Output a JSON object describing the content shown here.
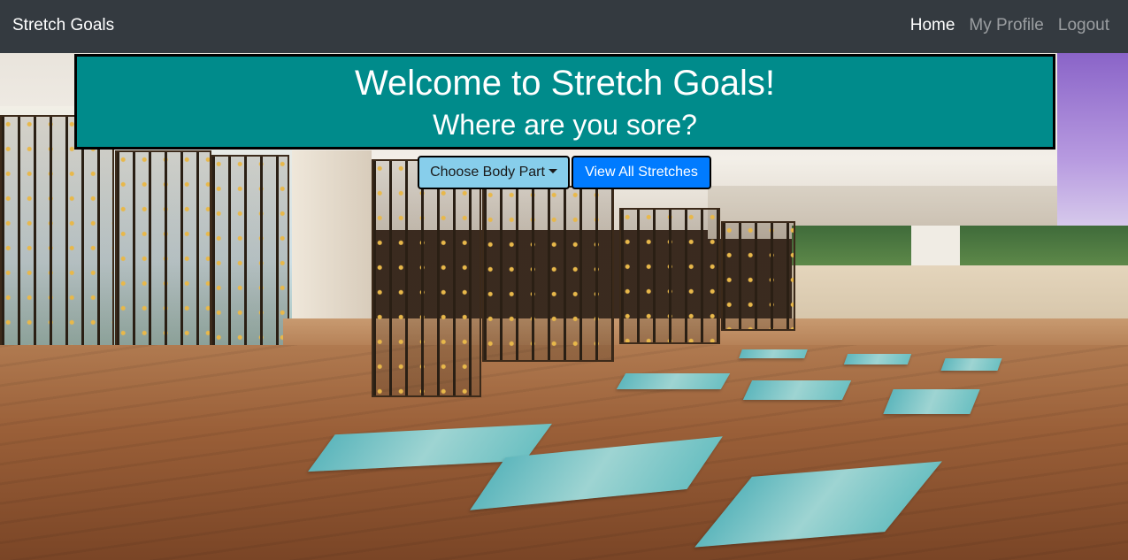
{
  "navbar": {
    "brand": "Stretch Goals",
    "links": [
      "Home",
      "My Profile",
      "Logout"
    ],
    "active_link": "Home"
  },
  "hero": {
    "title": "Welcome to Stretch Goals!",
    "subtitle": "Where are you sore?"
  },
  "actions": {
    "choose_body_part": "Choose Body Part",
    "view_all": "View All Stretches"
  },
  "colors": {
    "navbar_bg": "#343a40",
    "jumbotron_bg": "#008b8b",
    "choose_button_bg": "#87ceeb",
    "view_all_button_bg": "#007bff"
  },
  "background": {
    "description_icon": "yoga-studio-image"
  }
}
